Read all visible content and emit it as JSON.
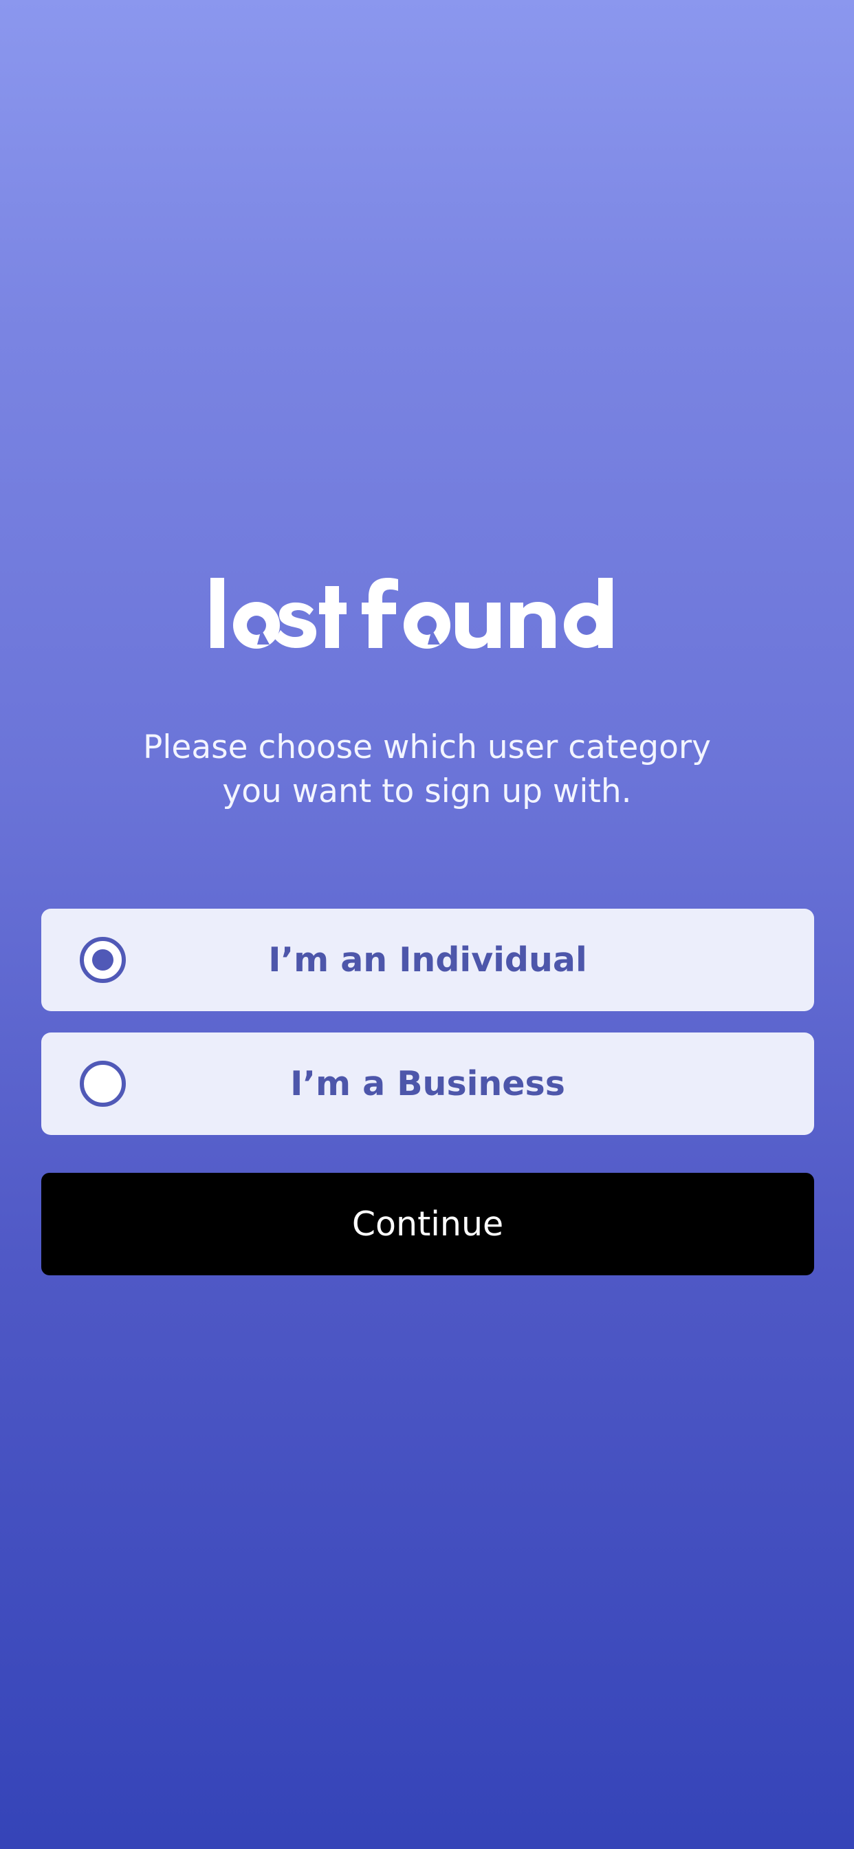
{
  "brand": {
    "logo_text": "lostfound"
  },
  "intro": {
    "line1": "Please choose which user category",
    "line2": "you want to sign up with."
  },
  "user_category": {
    "selected": "individual",
    "options": [
      {
        "id": "individual",
        "label": "I’m an Individual",
        "checked": true
      },
      {
        "id": "business",
        "label": "I’m a Business",
        "checked": false
      }
    ]
  },
  "actions": {
    "continue_label": "Continue"
  },
  "colors": {
    "gradient_top": "#8b97ee",
    "gradient_bottom": "#3544b8",
    "card_background": "#eceefb",
    "accent": "#5059b7",
    "button_background": "#000000"
  }
}
